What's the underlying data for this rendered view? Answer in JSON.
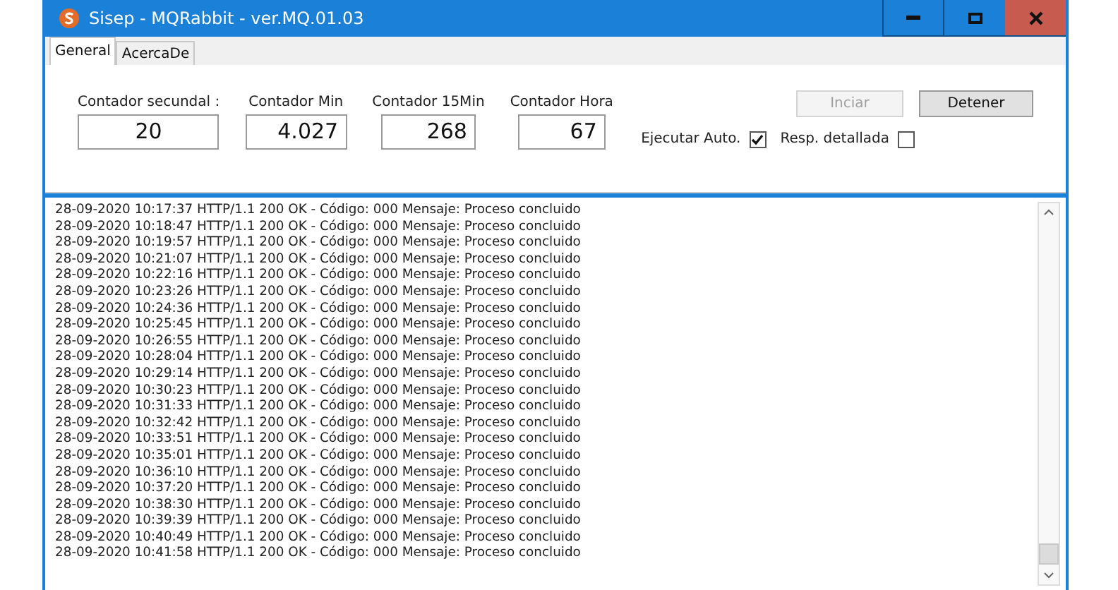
{
  "window": {
    "title": "Sisep - MQRabbit - ver.MQ.01.03"
  },
  "tabs": [
    {
      "label": "General",
      "selected": true
    },
    {
      "label": "AcercaDe",
      "selected": false
    }
  ],
  "counters": [
    {
      "label": "Contador secundal :",
      "value": "20"
    },
    {
      "label": "Contador Min",
      "value": "4.027"
    },
    {
      "label": "Contador 15Min",
      "value": "268"
    },
    {
      "label": "Contador Hora",
      "value": "67"
    }
  ],
  "buttons": [
    {
      "label": "Inciar",
      "disabled": true
    },
    {
      "label": "Detener",
      "disabled": false
    }
  ],
  "checkboxes": [
    {
      "label": "Ejecutar Auto.",
      "checked": true
    },
    {
      "label": "Resp. detallada",
      "checked": false
    }
  ],
  "log": [
    "28-09-2020 10:17:37 HTTP/1.1 200 OK - Código: 000 Mensaje: Proceso concluido",
    "28-09-2020 10:18:47 HTTP/1.1 200 OK - Código: 000 Mensaje: Proceso concluido",
    "28-09-2020 10:19:57 HTTP/1.1 200 OK - Código: 000 Mensaje: Proceso concluido",
    "28-09-2020 10:21:07 HTTP/1.1 200 OK - Código: 000 Mensaje: Proceso concluido",
    "28-09-2020 10:22:16 HTTP/1.1 200 OK - Código: 000 Mensaje: Proceso concluido",
    "28-09-2020 10:23:26 HTTP/1.1 200 OK - Código: 000 Mensaje: Proceso concluido",
    "28-09-2020 10:24:36 HTTP/1.1 200 OK - Código: 000 Mensaje: Proceso concluido",
    "28-09-2020 10:25:45 HTTP/1.1 200 OK - Código: 000 Mensaje: Proceso concluido",
    "28-09-2020 10:26:55 HTTP/1.1 200 OK - Código: 000 Mensaje: Proceso concluido",
    "28-09-2020 10:28:04 HTTP/1.1 200 OK - Código: 000 Mensaje: Proceso concluido",
    "28-09-2020 10:29:14 HTTP/1.1 200 OK - Código: 000 Mensaje: Proceso concluido",
    "28-09-2020 10:30:23 HTTP/1.1 200 OK - Código: 000 Mensaje: Proceso concluido",
    "28-09-2020 10:31:33 HTTP/1.1 200 OK - Código: 000 Mensaje: Proceso concluido",
    "28-09-2020 10:32:42 HTTP/1.1 200 OK - Código: 000 Mensaje: Proceso concluido",
    "28-09-2020 10:33:51 HTTP/1.1 200 OK - Código: 000 Mensaje: Proceso concluido",
    "28-09-2020 10:35:01 HTTP/1.1 200 OK - Código: 000 Mensaje: Proceso concluido",
    "28-09-2020 10:36:10 HTTP/1.1 200 OK - Código: 000 Mensaje: Proceso concluido",
    "28-09-2020 10:37:20 HTTP/1.1 200 OK - Código: 000 Mensaje: Proceso concluido",
    "28-09-2020 10:38:30 HTTP/1.1 200 OK - Código: 000 Mensaje: Proceso concluido",
    "28-09-2020 10:39:39 HTTP/1.1 200 OK - Código: 000 Mensaje: Proceso concluido",
    "28-09-2020 10:40:49 HTTP/1.1 200 OK - Código: 000 Mensaje: Proceso concluido",
    "28-09-2020 10:41:58 HTTP/1.1 200 OK - Código: 000 Mensaje: Proceso concluido"
  ]
}
